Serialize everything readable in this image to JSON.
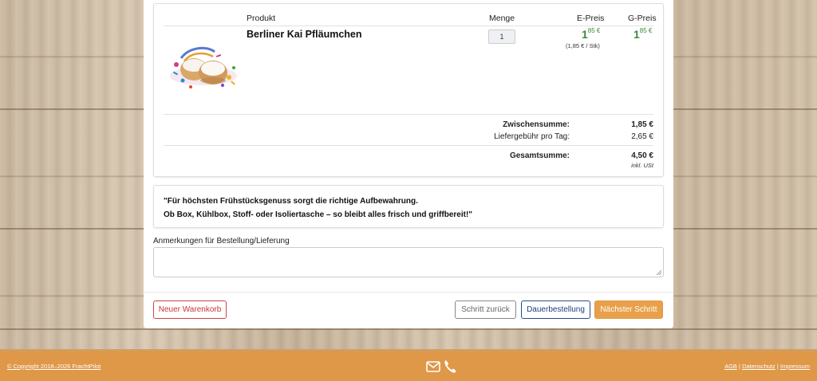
{
  "cart": {
    "headers": {
      "product": "Produkt",
      "quantity": "Menge",
      "unit_price": "E-Preis",
      "total_price": "G-Preis"
    },
    "item": {
      "name": "Berliner Kai Pfläumchen",
      "quantity": "1",
      "unit_price_main": "1",
      "unit_price_cents": "85 €",
      "unit_price_note": "(1,85 € / Stk)",
      "total_price_main": "1",
      "total_price_cents": "85 €",
      "image_icon": "berliner-donut-image"
    },
    "summary": {
      "subtotal_label": "Zwischensumme:",
      "subtotal_value": "1,85 €",
      "delivery_label": "Liefergebühr pro Tag:",
      "delivery_value": "2,65 €",
      "total_label": "Gesamtsumme:",
      "total_value": "4,50 €",
      "tax_note": "inkl. USt"
    }
  },
  "quote": {
    "line1": "\"Für höchsten Frühstücksgenuss sorgt die richtige Aufbewahrung.",
    "line2": "Ob Box, Kühlbox, Stoff- oder Isoliertasche – so bleibt alles frisch und griffbereit!\""
  },
  "notes": {
    "label": "Anmerkungen für Bestellung/Lieferung",
    "value": ""
  },
  "buttons": {
    "new_cart": "Neuer Warenkorb",
    "back": "Schritt zurück",
    "subscription": "Dauerbestellung",
    "next": "Nächster Schritt"
  },
  "footer": {
    "copyright": "© Copyright 2018–2026 FrachtPilot",
    "links": [
      "AGB",
      "Datenschutz",
      "Impressum"
    ],
    "separator": "|",
    "icons": [
      "envelope-icon",
      "phone-icon"
    ]
  },
  "colors": {
    "accent": "#df9748",
    "price_green": "#3a8a3a",
    "danger": "#c33",
    "primary_outline": "#1f3f7a"
  }
}
